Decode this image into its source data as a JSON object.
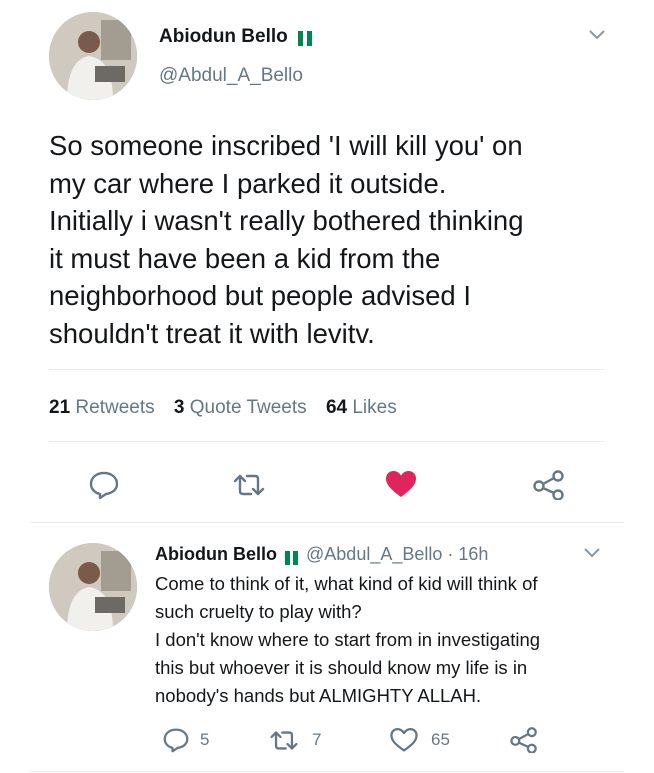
{
  "tweet": {
    "author_name": "Abiodun Bello",
    "author_handle": "@Abdul_A_Bello",
    "text_lines": [
      "So someone inscribed 'I will kill you' on",
      "my car where I parked it outside.",
      "Initially i wasn't really bothered thinking",
      "it must have been a kid from the",
      "neighborhood but people advised I",
      "shouldn't treat it with levitv."
    ],
    "stats": {
      "retweets_count": "21",
      "retweets_label": "Retweets",
      "quotes_count": "3",
      "quotes_label": "Quote Tweets",
      "likes_count": "64",
      "likes_label": "Likes"
    }
  },
  "reply": {
    "author_name": "Abiodun Bello",
    "author_handle": "@Abdul_A_Bello",
    "time": "· 16h",
    "text_lines": [
      "Come to think of it, what kind of kid will think of",
      "such cruelty to play with?",
      "I don't know where to start from in investigating",
      "this but whoever it is should know my life is in",
      "nobody's hands but ALMIGHTY ALLAH."
    ],
    "reply_count": "5",
    "retweet_count": "7",
    "like_count": "65"
  },
  "colors": {
    "like_active": "#e0245e",
    "icon_gray": "#657786",
    "flag_green": "#008751"
  },
  "icons": [
    "chevron-down-icon",
    "reply-icon",
    "retweet-icon",
    "heart-icon",
    "share-icon"
  ]
}
